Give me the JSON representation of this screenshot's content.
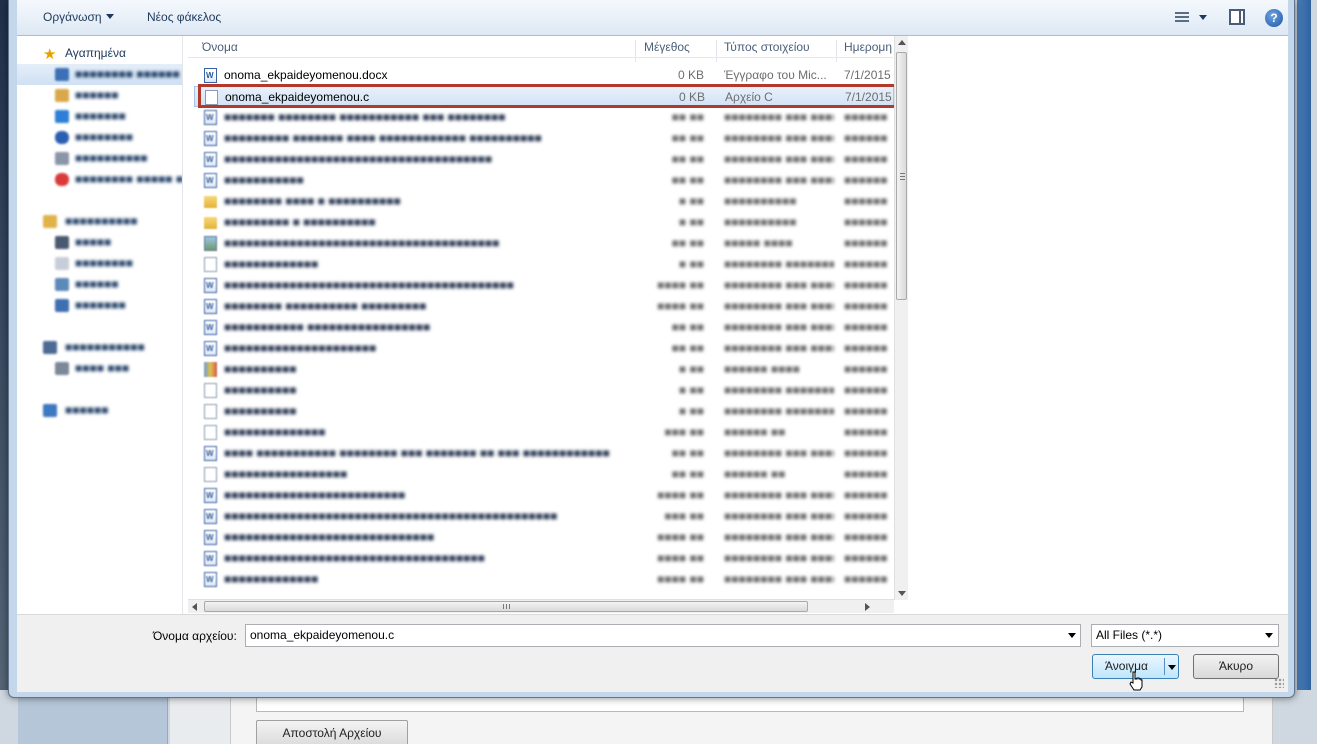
{
  "toolbar": {
    "organize_label": "Οργάνωση",
    "new_folder_label": "Νέος φάκελος",
    "help_label": "?"
  },
  "nav": {
    "favorites_label": "Αγαπημένα"
  },
  "columns": {
    "name": "Όνομα",
    "size": "Μέγεθος",
    "type": "Τύπος στοιχείου",
    "date": "Ημερομηνία"
  },
  "files": [
    {
      "name": "onoma_ekpaideyomenou.docx",
      "size": "0 KB",
      "type": "Έγγραφο του Mic...",
      "date": "7/1/2015"
    },
    {
      "name": "onoma_ekpaideyomenou.c",
      "size": "0 KB",
      "type": "Αρχείο C",
      "date": "7/1/2015"
    }
  ],
  "footer": {
    "filename_label": "Όνομα αρχείου:",
    "filename_value": "onoma_ekpaideyomenou.c",
    "filter_value": "All Files (*.*)",
    "open_label": "Άνοιγμα",
    "cancel_label": "Άκυρο"
  },
  "background": {
    "upload_label": "Αποστολή Αρχείου"
  }
}
